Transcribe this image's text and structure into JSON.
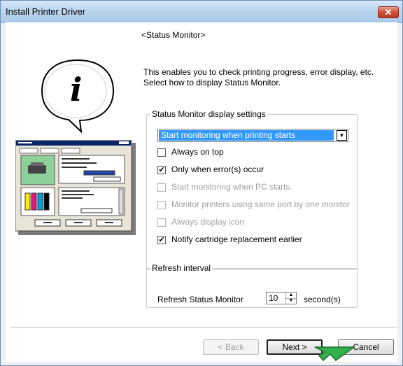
{
  "window": {
    "title": "Install Printer Driver",
    "close_glyph": "✕"
  },
  "page": {
    "heading": "<Status Monitor>",
    "description_line1": "This enables you to check printing progress, error display, etc.",
    "description_line2": "Select how to display Status Monitor."
  },
  "display_settings": {
    "group_title": "Status Monitor display settings",
    "dropdown_value": "Start monitoring when printing starts",
    "options": [
      {
        "label": "Always on top",
        "checked": false,
        "enabled": true
      },
      {
        "label": "Only when error(s) occur",
        "checked": true,
        "enabled": true
      },
      {
        "label": "Start monitoring when PC starts.",
        "checked": false,
        "enabled": false
      },
      {
        "label": "Monitor printers using same port by one monitor",
        "checked": false,
        "enabled": false
      },
      {
        "label": "Always display icon",
        "checked": false,
        "enabled": false
      },
      {
        "label": "Notify cartridge replacement earlier",
        "checked": true,
        "enabled": true
      }
    ]
  },
  "refresh": {
    "group_title": "Refresh interval",
    "label": "Refresh Status Monitor",
    "value": "10",
    "unit": "second(s)"
  },
  "buttons": {
    "back": "< Back",
    "next": "Next >",
    "cancel": "Cancel"
  },
  "illustration": {
    "speech_bubble_glyph": "i",
    "accent_color": "#0a246a"
  }
}
